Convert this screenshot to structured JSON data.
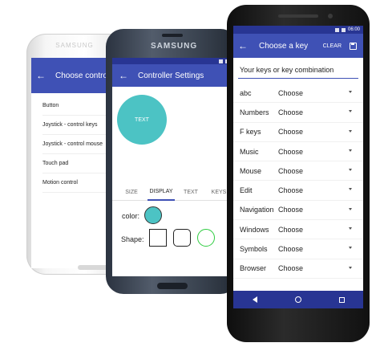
{
  "phone1": {
    "brand": "SAMSUNG",
    "header_title": "Choose controller",
    "items": [
      "Button",
      "Joystick - control keys",
      "Joystick - control mouse",
      "Touch pad",
      "Motion control"
    ]
  },
  "phone2": {
    "brand": "SAMSUNG",
    "header_title": "Controller Settings",
    "preview_label": "TEXT",
    "tabs": [
      "SIZE",
      "DISPLAY",
      "TEXT",
      "KEYS"
    ],
    "color_label": "color:",
    "shape_label": "Shape:",
    "accent_color": "#4cc3c4"
  },
  "phone3": {
    "status_time": "06:00",
    "header_title": "Choose a key",
    "clear_label": "CLEAR",
    "input_label": "Your keys or key combination",
    "rows": [
      {
        "key": "abc",
        "value": "Choose"
      },
      {
        "key": "Numbers",
        "value": "Choose"
      },
      {
        "key": "F keys",
        "value": "Choose"
      },
      {
        "key": "Music",
        "value": "Choose"
      },
      {
        "key": "Mouse",
        "value": "Choose"
      },
      {
        "key": "Edit",
        "value": "Choose"
      },
      {
        "key": "Navigation",
        "value": "Choose"
      },
      {
        "key": "Windows",
        "value": "Choose"
      },
      {
        "key": "Symbols",
        "value": "Choose"
      },
      {
        "key": "Browser",
        "value": "Choose"
      }
    ],
    "primary_color": "#3f51b5",
    "dark_color": "#283593"
  }
}
